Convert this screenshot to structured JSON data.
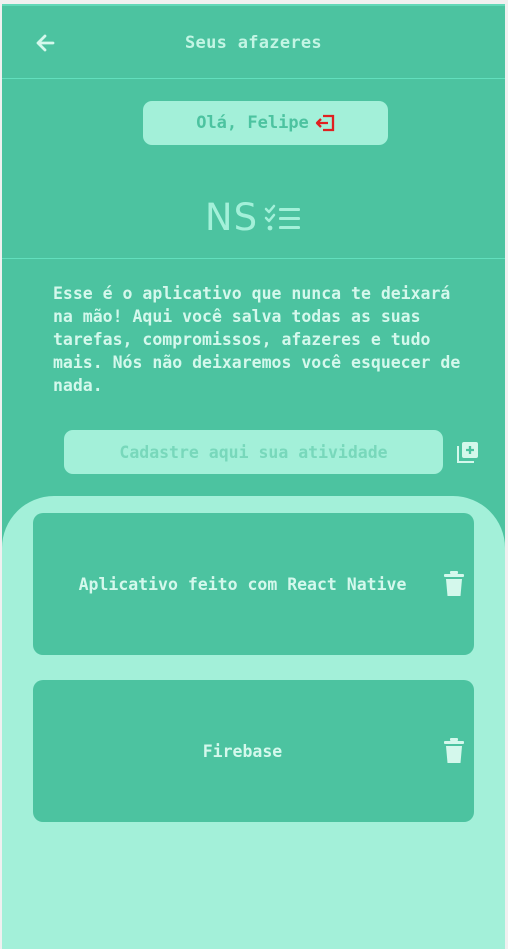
{
  "header": {
    "title": "Seus afazeres",
    "back_icon": "arrow-left-icon"
  },
  "greeting": {
    "label": "Olá, Felipe",
    "logout_icon": "logout-icon",
    "logout_color": "#e02020"
  },
  "logo": {
    "text": "NS",
    "icon": "checklist-icon"
  },
  "description": "Esse é o aplicativo que nunca te deixará na mão! Aqui você salva todas as suas tarefas, compromissos, afazeres e tudo mais. Nós não deixaremos você esquecer de nada.",
  "new_task": {
    "placeholder": "Cadastre aqui sua atividade",
    "value": "",
    "add_icon": "add-box-icon"
  },
  "tasks": [
    {
      "name": "Aplicativo feito com React Native",
      "delete_icon": "trash-icon"
    },
    {
      "name": "Firebase",
      "delete_icon": "trash-icon"
    }
  ],
  "colors": {
    "background": "#4cc3a0",
    "surface_light": "#a3f0d9",
    "text_light": "#d4f8ec",
    "accent_red": "#e02020"
  }
}
